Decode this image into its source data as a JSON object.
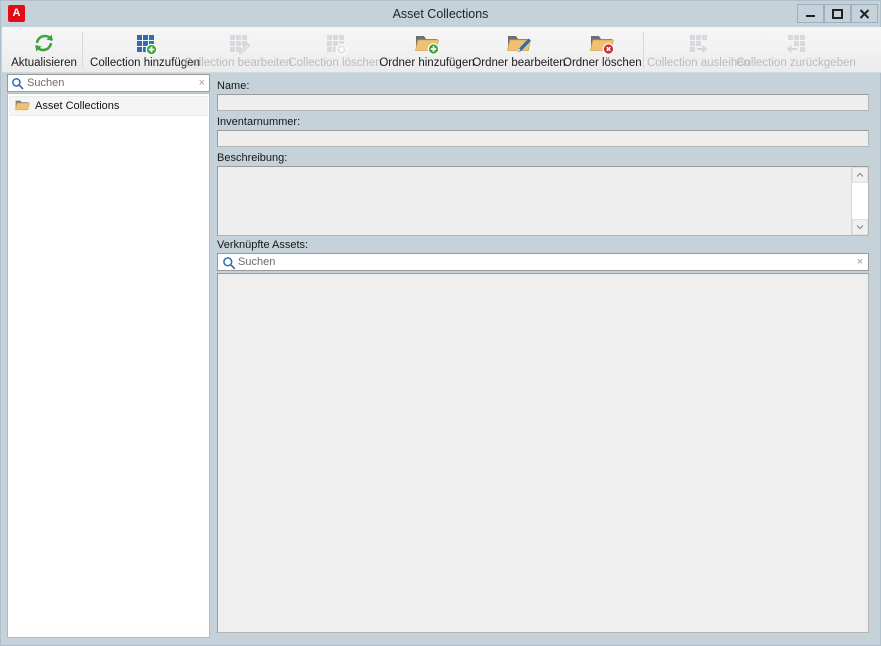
{
  "window": {
    "title": "Asset Collections",
    "app_icon": "A",
    "controls": {
      "minimize": "minimize-icon",
      "maximize": "maximize-icon",
      "close": "close-icon"
    }
  },
  "toolbar": {
    "items": [
      {
        "label": "Aktualisieren",
        "icon": "refresh-icon",
        "enabled": true
      },
      {
        "label": "Collection hinzufügen",
        "icon": "grid-add-icon",
        "enabled": true
      },
      {
        "label": "Collection bearbeiten",
        "icon": "grid-edit-icon",
        "enabled": false
      },
      {
        "label": "Collection löschen",
        "icon": "grid-delete-icon",
        "enabled": false
      },
      {
        "label": "Ordner hinzufügen",
        "icon": "folder-add-icon",
        "enabled": true
      },
      {
        "label": "Ordner bearbeiten",
        "icon": "folder-edit-icon",
        "enabled": true
      },
      {
        "label": "Ordner löschen",
        "icon": "folder-delete-icon",
        "enabled": true
      },
      {
        "label": "Collection ausleihen",
        "icon": "grid-checkout-icon",
        "enabled": false
      },
      {
        "label": "Collection zurückgeben",
        "icon": "grid-checkin-icon",
        "enabled": false
      }
    ]
  },
  "sidebar": {
    "search": {
      "placeholder": "Suchen",
      "value": "",
      "icon": "search-icon",
      "clear": "×"
    },
    "tree": {
      "items": [
        {
          "label": "Asset Collections",
          "icon": "folder-icon"
        }
      ]
    }
  },
  "form": {
    "name": {
      "label": "Name:",
      "value": "",
      "placeholder": ""
    },
    "inventory": {
      "label": "Inventarnummer:",
      "value": "",
      "placeholder": ""
    },
    "description": {
      "label": "Beschreibung:",
      "value": "",
      "placeholder": ""
    },
    "linked_assets": {
      "label": "Verknüpfte Assets:",
      "search": {
        "placeholder": "Suchen",
        "value": "",
        "icon": "search-icon",
        "clear": "×"
      },
      "items": []
    }
  },
  "colors": {
    "window_chrome": "#c5d2da",
    "toolbar": "#f1f1f1",
    "accent_green": "#3aa43a",
    "accent_blue": "#2e6db4",
    "accent_red": "#cf2a2a",
    "folder_orange": "#e7b562",
    "disabled_grey": "#c8cdd1",
    "field_bg": "#eeeeee"
  }
}
